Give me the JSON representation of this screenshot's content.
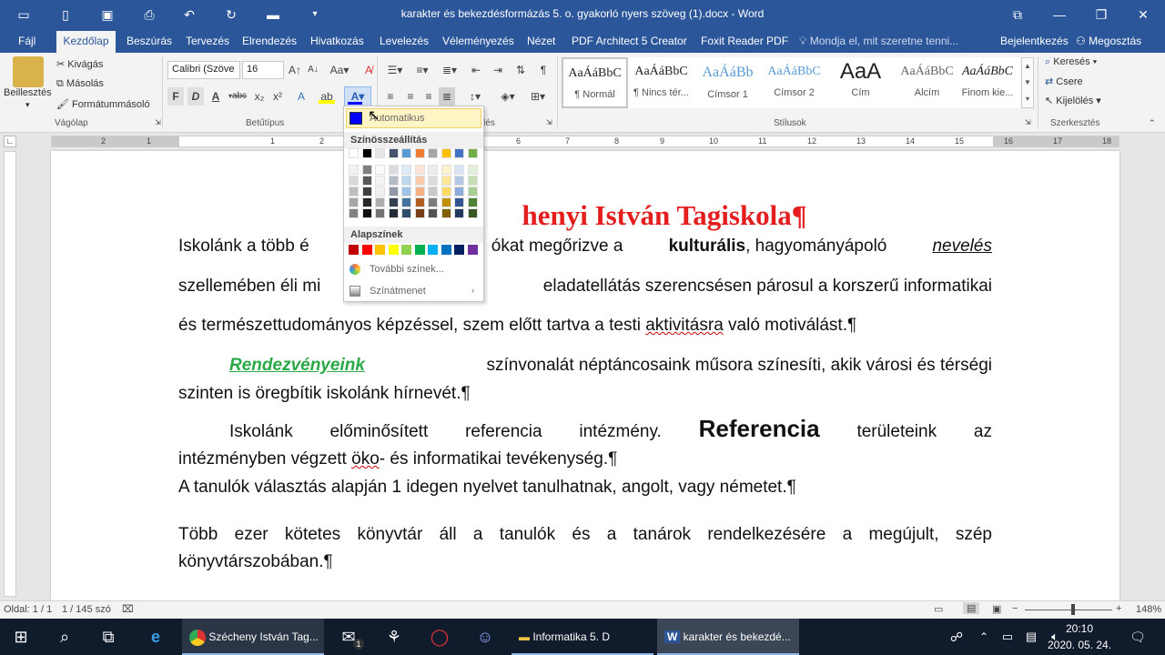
{
  "window": {
    "title": "karakter és bekezdésformázás 5. o. gyakorló nyers szöveg (1).docx - Word"
  },
  "tabs": [
    "Fájl",
    "Kezdőlap",
    "Beszúrás",
    "Tervezés",
    "Elrendezés",
    "Hivatkozás",
    "Levelezés",
    "Véleményezés",
    "Nézet",
    "PDF Architect 5 Creator",
    "Foxit Reader PDF"
  ],
  "tell_me": "Mondja el, mit szeretne tenni...",
  "account": {
    "signin": "Bejelentkezés",
    "share": "Megosztás"
  },
  "clipboard": {
    "paste": "Beillesztés",
    "cut": "Kivágás",
    "copy": "Másolás",
    "format_painter": "Formátummásoló",
    "label": "Vágólap"
  },
  "font": {
    "name": "Calibri (Szöve",
    "size": "16",
    "label": "Betűtípus",
    "bold": "F",
    "italic": "D",
    "underline": "A"
  },
  "styles": {
    "label": "Stílusok",
    "items": [
      {
        "preview": "AaÁáBbC",
        "name": "¶ Normál"
      },
      {
        "preview": "AaÁáBbC",
        "name": "¶ Nincs tér..."
      },
      {
        "preview": "AaÁáBb",
        "name": "Címsor 1"
      },
      {
        "preview": "AaÁáBbC",
        "name": "Címsor 2"
      },
      {
        "preview": "AaA",
        "name": "Cím"
      },
      {
        "preview": "AaÁáBbC",
        "name": "Alcím"
      },
      {
        "preview": "AaÁáBbC",
        "name": "Finom kie..."
      }
    ]
  },
  "editing": {
    "find": "Keresés",
    "replace": "Csere",
    "select": "Kijelölés",
    "label": "Szerkesztés"
  },
  "paragraph_label": "Bekezdés",
  "color_menu": {
    "automatic": "Automatikus",
    "theme_header": "Színösszeállítás",
    "standard_header": "Alapszínek",
    "more_colors": "További színek...",
    "gradient": "Színátmenet",
    "theme_colors": [
      "#ffffff",
      "#000000",
      "#e7e6e6",
      "#44546a",
      "#5b9bd5",
      "#ed7d31",
      "#a5a5a5",
      "#ffc000",
      "#4472c4",
      "#70ad47"
    ],
    "standard_colors": [
      "#c00000",
      "#ff0000",
      "#ffc000",
      "#ffff00",
      "#92d050",
      "#00b050",
      "#00b0f0",
      "#0070c0",
      "#002060",
      "#7030a0"
    ]
  },
  "ruler_numbers": [
    "2",
    "1",
    "1",
    "2",
    "3",
    "4",
    "5",
    "6",
    "7",
    "8",
    "9",
    "10",
    "11",
    "12",
    "13",
    "14",
    "15",
    "16",
    "17",
    "18"
  ],
  "document": {
    "heading_visible": "henyi István Tagiskola¶",
    "p1_line1": {
      "a": "Iskolánk a több é",
      "b": "ókat megőrizve a",
      "bold": "kulturális",
      "c": ", hagyományápoló",
      "it": "nevelés"
    },
    "p1_line2": {
      "a": "szellemében éli mi",
      "b": "eladatellátás szerencsésen párosul a korszerű informatikai"
    },
    "p1_line3": {
      "a": "és természettudományos képzéssel, szem előtt tartva a testi ",
      "err": "aktivitásra",
      "b": " való motiválást.¶"
    },
    "p2": {
      "link": "Rendezvényeink",
      "line1": "színvonalát néptáncosaink műsora színesíti, akik városi és térségi",
      "line2": "szinten is öregbítik iskolánk hírnevét.¶"
    },
    "p3": {
      "line1_words": [
        "Iskolánk",
        "előminősített",
        "referencia",
        "intézmény."
      ],
      "bigword": "Referencia",
      "line1_tail": [
        "területeink",
        "az"
      ],
      "line2_a": "intézményben végzett ",
      "line2_err": "öko",
      "line2_b": "- és informatikai tevékenység.¶"
    },
    "p4": "A tanulók választás alapján 1 idegen nyelvet tanulhatnak, angolt, vagy németet.¶",
    "p5": {
      "line1": "Több ezer kötetes könyvtár áll a tanulók és a tanárok rendelkezésére a megújult, szép",
      "line2": "könyvtárszobában.¶"
    }
  },
  "status": {
    "page": "Oldal: 1 / 1",
    "words": "1 / 145 szó",
    "zoom": "148%"
  },
  "taskbar": {
    "apps": [
      "Szécheny István Tag...",
      "Informatika 5. D",
      "karakter és bekezdé..."
    ],
    "time": "20:10",
    "date": "2020. 05. 24.",
    "mail_badge": "1"
  }
}
